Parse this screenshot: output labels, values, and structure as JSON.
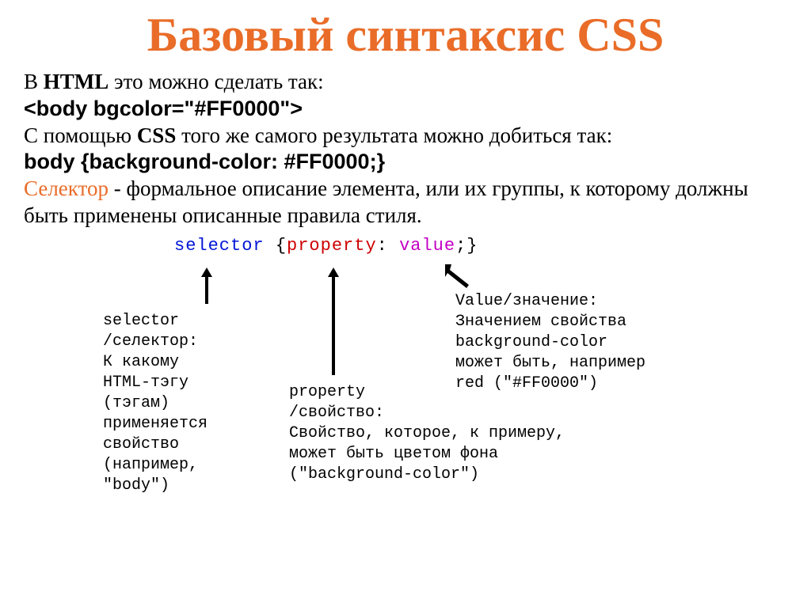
{
  "title": "Базовый синтаксис CSS",
  "intro": {
    "line1a": "В ",
    "line1b": "HTML",
    "line1c": " это можно сделать так:",
    "code1": "<body bgcolor=\"#FF0000\">",
    "line2a": "С помощью ",
    "line2b": "CSS",
    "line2c": " того же самого результата можно добиться так:",
    "code2": " body {background-color: #FF0000;}",
    "selector_label": "Селектор",
    "selector_desc": " - формальное описание элемента, или их группы, к которому должны быть применены описанные правила стиля."
  },
  "syntax": {
    "selector": "selector",
    "open": " {",
    "property": "property",
    "colon": ": ",
    "value": "value",
    "close": ";}"
  },
  "columns": {
    "selector": "selector\n/селектор:\nК какому\nHTML-тэгу\n(тэгам)\nприменяется\nсвойство\n(например,\n\"body\")",
    "property": "property\n/свойство:\nСвойство, которое, к примеру,\nможет быть цветом фона\n(\"background-color\")",
    "value": "Value/значение:\nЗначением свойства\nbackground-color\nможет быть, например\nred (\"#FF0000\")"
  }
}
